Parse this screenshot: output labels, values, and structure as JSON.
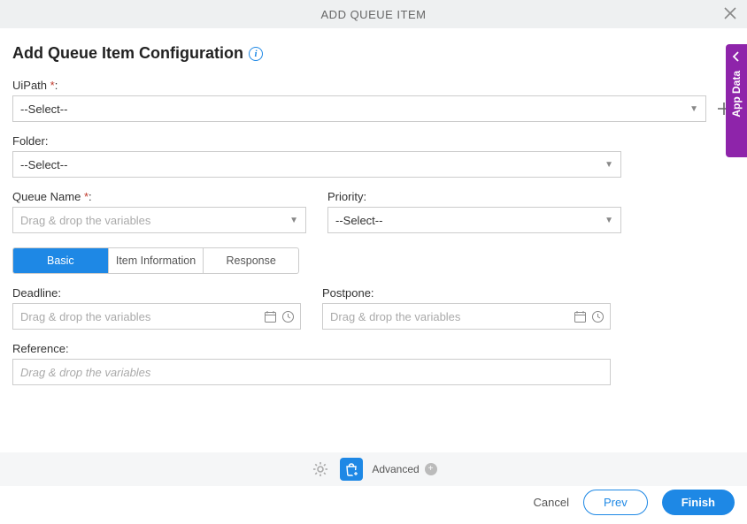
{
  "header": {
    "title": "ADD QUEUE ITEM"
  },
  "page": {
    "title": "Add Queue Item Configuration"
  },
  "fields": {
    "uipath": {
      "label": "UiPath ",
      "req": "*",
      "colon": ":",
      "value": "--Select--"
    },
    "folder": {
      "label": "Folder:",
      "value": "--Select--"
    },
    "queue_name": {
      "label": "Queue Name ",
      "req": "*",
      "colon": ":",
      "placeholder": "Drag & drop the variables"
    },
    "priority": {
      "label": "Priority:",
      "value": "--Select--"
    },
    "deadline": {
      "label": "Deadline:",
      "placeholder": "Drag & drop the variables"
    },
    "postpone": {
      "label": "Postpone:",
      "placeholder": "Drag & drop the variables"
    },
    "reference": {
      "label": "Reference:",
      "placeholder": "Drag & drop the variables"
    }
  },
  "tabs": {
    "basic": "Basic",
    "item_info": "Item Information",
    "response": "Response"
  },
  "footer": {
    "advanced": "Advanced"
  },
  "buttons": {
    "cancel": "Cancel",
    "prev": "Prev",
    "finish": "Finish"
  },
  "side_panel": {
    "label": "App Data"
  }
}
